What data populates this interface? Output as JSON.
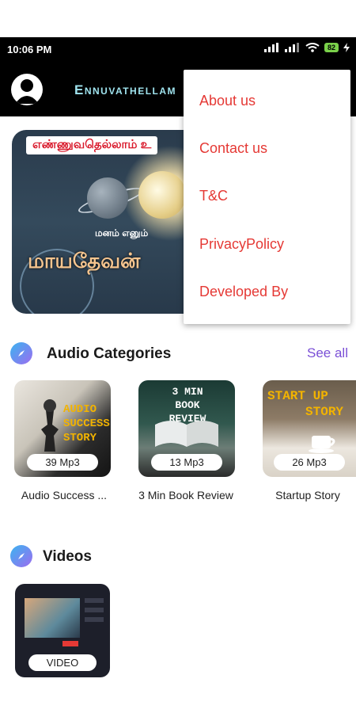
{
  "status_bar": {
    "time": "10:06 PM",
    "battery": "82"
  },
  "app_bar": {
    "title": "Ennuvathellam"
  },
  "banner": {
    "top_text": "எண்ணுவதெல்லாம் உ",
    "subtitle": "மனம் எனும்",
    "main_text": "மாயதேவன்"
  },
  "menu": {
    "items": [
      {
        "label": "About us"
      },
      {
        "label": "Contact us"
      },
      {
        "label": "T&C"
      },
      {
        "label": "PrivacyPolicy"
      },
      {
        "label": "Developed By"
      }
    ]
  },
  "audio_categories": {
    "title": "Audio Categories",
    "see_all": "See all",
    "items": [
      {
        "name": "Audio Success ...",
        "count": "39 Mp3",
        "cover_text": "AUDIO\nSUCCESS\nSTORY"
      },
      {
        "name": "3 Min Book Review",
        "count": "13 Mp3",
        "cover_text": "3 MIN\nBOOK REVIEW"
      },
      {
        "name": "Startup Story",
        "count": "26 Mp3",
        "cover_text": "START UP\nSTORY"
      }
    ]
  },
  "videos": {
    "title": "Videos",
    "items": [
      {
        "badge": "VIDEO"
      }
    ]
  },
  "colors": {
    "accent": "#7a4fd6",
    "menu_text": "#e53935",
    "appbar": "#000000"
  }
}
